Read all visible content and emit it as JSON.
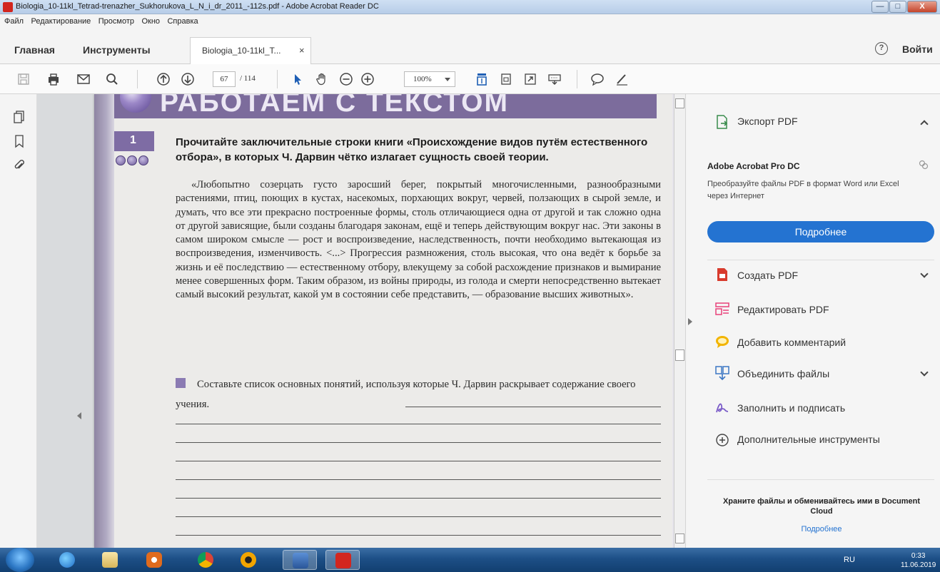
{
  "window": {
    "title": "Biologia_10-11kl_Tetrad-trenazher_Sukhorukova_L_N_i_dr_2011_-112s.pdf - Adobe Acrobat Reader DC",
    "min_glyph": "—",
    "max_glyph": "□",
    "close_glyph": "X"
  },
  "menu": [
    "Файл",
    "Редактирование",
    "Просмотр",
    "Окно",
    "Справка"
  ],
  "tabs": {
    "home": "Главная",
    "tools": "Инструменты",
    "doc": "Biologia_10-11kl_T...",
    "close": "×",
    "help": "?",
    "login": "Войти"
  },
  "toolbar": {
    "page_current": "67",
    "page_total": "/ 114",
    "zoom": "100%"
  },
  "document": {
    "header_title": "РАБОТАЕМ С ТЕКСТОМ",
    "task_number": "1",
    "task_heading": "Прочитайте заключительные строки книги «Происхождение видов путём естественного отбора», в которых Ч. Дарвин чётко излагает сущность своей теории.",
    "quote": "«Любопытно созерцать густо заросший берег, покрытый многочисленными, разнообразными растениями, птиц, поющих в кустах, насекомых, порхающих вокруг, червей, ползающих в сырой земле, и думать, что все эти прекрасно построенные формы, столь отличающиеся одна от другой и так сложно одна от другой зависящие, были созданы благодаря законам, ещё и теперь действующим вокруг нас. Эти законы в самом широком смысле — рост и воспроизведение, наследственность, почти необходимо вытекающая из воспроизведения, изменчивость. <...> Прогрессия размножения, столь высокая, что она ведёт к борьбе за жизнь и её последствию — естественному отбору, влекущему за собой расхождение признаков и вымирание менее совершенных форм. Таким образом, из войны природы, из голода и смерти непосредственно вытекает самый высокий результат, какой ум в состоянии себе представить, — образование высших животных».",
    "task2": "Составьте список основных понятий, используя которые Ч. Дарвин раскрывает содержание своего учения."
  },
  "right_panel": {
    "export_pdf": "Экспорт PDF",
    "promo_title": "Adobe Acrobat Pro DC",
    "promo_desc": "Преобразуйте файлы PDF в формат Word или Excel через Интернет",
    "promo_button": "Подробнее",
    "tools": [
      {
        "label": "Создать PDF",
        "icon": "create-pdf-icon",
        "color": "#d83b2d"
      },
      {
        "label": "Редактировать PDF",
        "icon": "edit-pdf-icon",
        "color": "#e8417a"
      },
      {
        "label": "Добавить комментарий",
        "icon": "comment-icon",
        "color": "#f2b400"
      },
      {
        "label": "Объединить файлы",
        "icon": "combine-files-icon",
        "color": "#3b76c4"
      },
      {
        "label": "Заполнить и подписать",
        "icon": "fill-sign-icon",
        "color": "#7a5bc8"
      },
      {
        "label": "Дополнительные инструменты",
        "icon": "more-tools-icon",
        "color": "#444444"
      }
    ],
    "cloud_text": "Храните файлы и обменивайтесь ими в Document Cloud",
    "cloud_link": "Подробнее"
  },
  "taskbar": {
    "lang": "RU",
    "time": "0:33",
    "date": "11.06.2019"
  },
  "colors": {
    "accent_blue": "#2473d1",
    "page_purple": "#7c6c9c",
    "acrobat_red": "#d2261f"
  }
}
